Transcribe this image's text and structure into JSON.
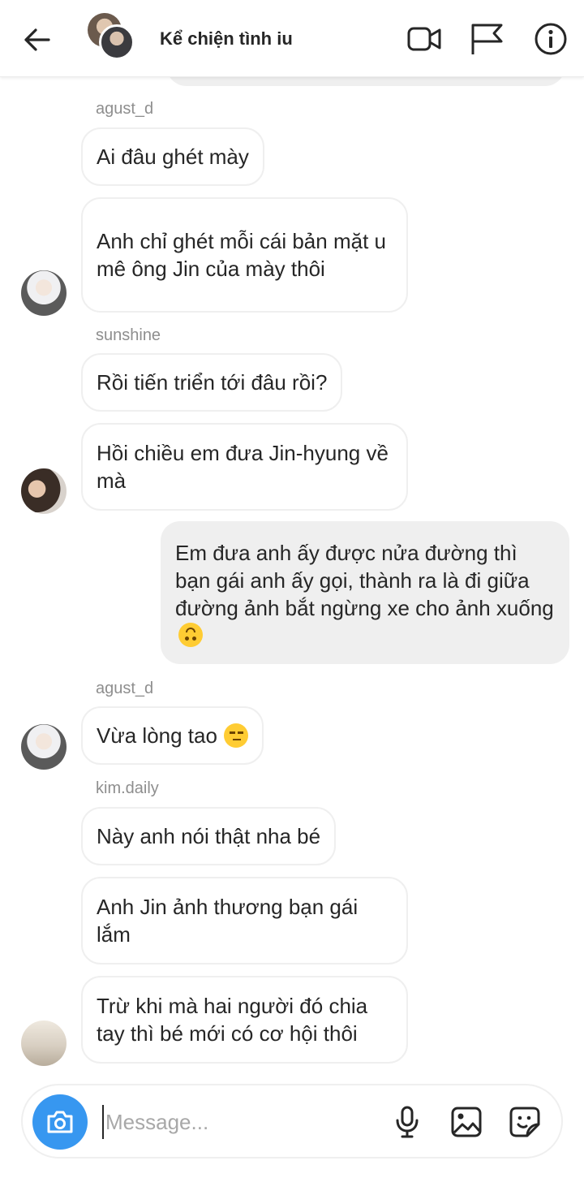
{
  "header": {
    "title": "Kể chiện tình iu",
    "back_icon": "arrow-left-icon",
    "video_icon": "video-camera-icon",
    "flag_icon": "flag-icon",
    "info_icon": "info-icon"
  },
  "messages": {
    "m1": {
      "sender": "agust_d",
      "text": "Ai đâu ghét mày"
    },
    "m2": {
      "text": "Anh chỉ ghét mỗi cái bản mặt u mê ông Jin của mày thôi"
    },
    "m3": {
      "sender": "sunshine",
      "text": "Rồi tiến triển tới đâu rồi?"
    },
    "m4": {
      "text": "Hồi chiều em đưa Jin-hyung về mà"
    },
    "m5": {
      "text": "Em đưa anh ấy được nửa đường thì bạn gái anh ấy gọi, thành ra là đi giữa đường ảnh bắt ngừng xe cho ảnh xuống"
    },
    "m6": {
      "sender": "agust_d",
      "text": "Vừa lòng tao"
    },
    "m7": {
      "sender": "kim.daily",
      "text": "Này anh nói thật nha bé"
    },
    "m8": {
      "text": "Anh Jin ảnh thương bạn gái lắm"
    },
    "m9": {
      "text": "Trừ khi mà hai người đó chia tay thì bé mới có cơ hội thôi"
    }
  },
  "composer": {
    "placeholder": "Message...",
    "camera_icon": "camera-icon",
    "mic_icon": "microphone-icon",
    "gallery_icon": "image-icon",
    "sticker_icon": "sticker-icon"
  },
  "colors": {
    "accent": "#3797f0",
    "outgoing_bubble": "#efefef",
    "incoming_border": "#efefef",
    "sender_text": "#8e8e8e"
  }
}
